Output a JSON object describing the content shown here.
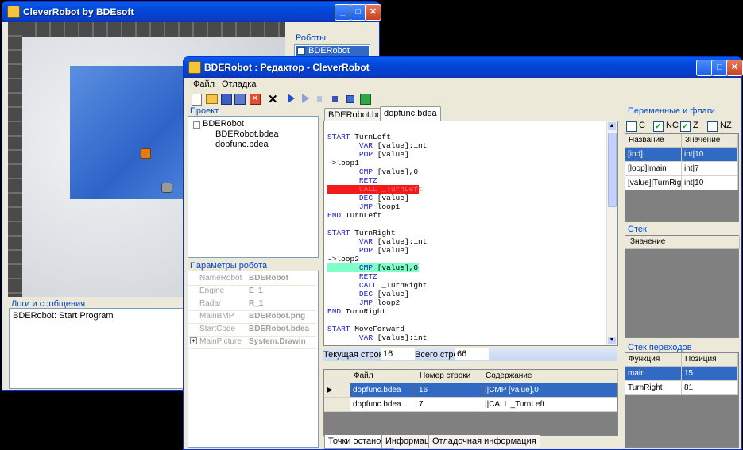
{
  "back_window": {
    "title": "CleverRobot by BDEsoft",
    "robots_label": "Роботы",
    "robot_item": "BDERobot",
    "logs_label": "Логи и сообщения",
    "log_line": "BDERobot: Start Program"
  },
  "editor": {
    "title": "BDERobot : Редактор - CleverRobot",
    "menu": [
      "Файл",
      "Отладка"
    ],
    "project": {
      "label": "Проект",
      "root": "BDERobot",
      "files": [
        "BDERobot.bdea",
        "dopfunc.bdea"
      ]
    },
    "robot_params": {
      "label": "Параметры робота",
      "rows": [
        {
          "name": "NameRobot",
          "value": "BDERobot"
        },
        {
          "name": "Engine",
          "value": "E_1"
        },
        {
          "name": "Radar",
          "value": "R_1"
        },
        {
          "name": "MainBMP",
          "value": "BDERobot.png"
        },
        {
          "name": "StartCode",
          "value": "BDERobot.bdea"
        },
        {
          "name": "MainPicture",
          "value": "System.Drawin"
        }
      ]
    },
    "file_tabs": [
      "BDERobot.bdea",
      "dopfunc.bdea"
    ],
    "code_lines": [
      {
        "indent": "",
        "kw": "START",
        "rest": " TurnLeft"
      },
      {
        "indent": "       ",
        "kw": "VAR",
        "rest": " [value]:int"
      },
      {
        "indent": "       ",
        "kw": "POP",
        "rest": " [value]"
      },
      {
        "indent": "",
        "kw": "",
        "rest": "->loop1"
      },
      {
        "indent": "       ",
        "kw": "CMP",
        "rest": " [value],0"
      },
      {
        "indent": "       ",
        "kw": "RETZ",
        "rest": ""
      },
      {
        "indent": "       ",
        "kw": "CALL",
        "rest": " _TurnLeft",
        "hl": "break"
      },
      {
        "indent": "       ",
        "kw": "DEC",
        "rest": " [value]"
      },
      {
        "indent": "       ",
        "kw": "JMP",
        "rest": " loop1"
      },
      {
        "indent": "",
        "kw": "END",
        "rest": " TurnLeft"
      },
      {
        "indent": "",
        "kw": "",
        "rest": ""
      },
      {
        "indent": "",
        "kw": "START",
        "rest": " TurnRight"
      },
      {
        "indent": "       ",
        "kw": "VAR",
        "rest": " [value]:int"
      },
      {
        "indent": "       ",
        "kw": "POP",
        "rest": " [value]"
      },
      {
        "indent": "",
        "kw": "",
        "rest": "->loop2"
      },
      {
        "indent": "       ",
        "kw": "CMP",
        "rest": " [value],0",
        "hl": "current"
      },
      {
        "indent": "       ",
        "kw": "RETZ",
        "rest": ""
      },
      {
        "indent": "       ",
        "kw": "CALL",
        "rest": " _TurnRight"
      },
      {
        "indent": "       ",
        "kw": "DEC",
        "rest": " [value]"
      },
      {
        "indent": "       ",
        "kw": "JMP",
        "rest": " loop2"
      },
      {
        "indent": "",
        "kw": "END",
        "rest": " TurnRight"
      },
      {
        "indent": "",
        "kw": "",
        "rest": ""
      },
      {
        "indent": "",
        "kw": "START",
        "rest": " MoveForward"
      },
      {
        "indent": "       ",
        "kw": "VAR",
        "rest": " [value]:int"
      }
    ],
    "current_line_label": "Текущая строка:",
    "current_line_value": "16",
    "total_lines_label": "Всего строк:",
    "total_lines_value": "66",
    "breakpoints": {
      "columns": [
        "Файл",
        "Номер строки",
        "Содержание"
      ],
      "rows": [
        {
          "file": "dopfunc.bdea",
          "line": "16",
          "content": "||CMP [value],0",
          "selected": true
        },
        {
          "file": "dopfunc.bdea",
          "line": "7",
          "content": "||CALL _TurnLeft",
          "selected": false
        }
      ]
    },
    "bottom_tabs": [
      "Точки останова",
      "Информация",
      "Отладочная информация"
    ],
    "vars_flags": {
      "label": "Переменные и флаги",
      "flags": [
        {
          "name": "C",
          "checked": false
        },
        {
          "name": "NC",
          "checked": true
        },
        {
          "name": "Z",
          "checked": true
        },
        {
          "name": "NZ",
          "checked": false
        }
      ],
      "columns": [
        "Название",
        "Значение"
      ],
      "rows": [
        {
          "name": "[ind]",
          "value": "int|10",
          "selected": true
        },
        {
          "name": "[loop]|main",
          "value": "int|7",
          "selected": false
        },
        {
          "name": "[value]|TurnRight",
          "value": "int|10",
          "selected": false
        }
      ]
    },
    "stack": {
      "label": "Стек",
      "column": "Значение"
    },
    "jump_stack": {
      "label": "Стек переходов",
      "columns": [
        "Функция",
        "Позиция"
      ],
      "rows": [
        {
          "func": "main",
          "pos": "15",
          "selected": true
        },
        {
          "func": "TurnRight",
          "pos": "81",
          "selected": false
        }
      ]
    }
  }
}
